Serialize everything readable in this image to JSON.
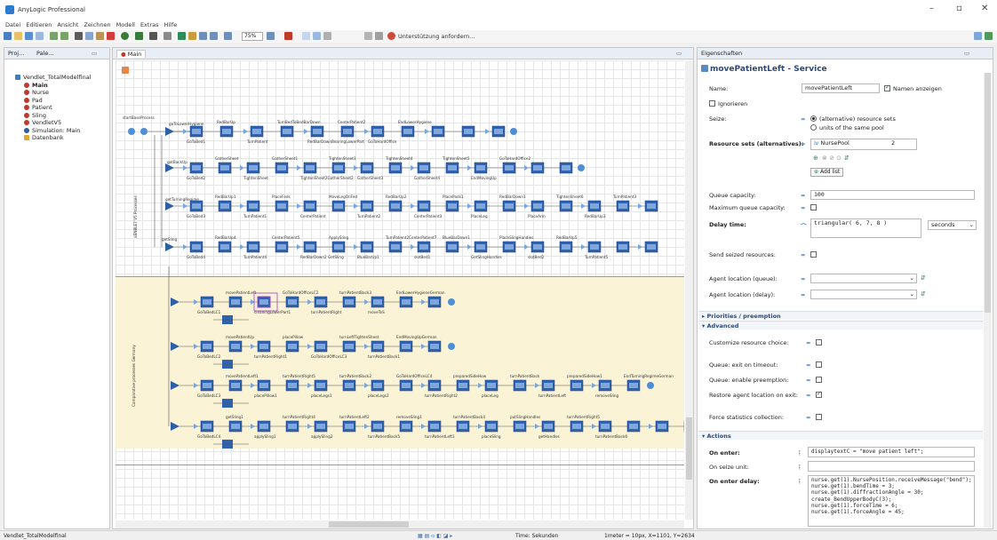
{
  "window": {
    "title": "AnyLogic Professional"
  },
  "menu": [
    "Datei",
    "Editieren",
    "Ansicht",
    "Zeichnen",
    "Modell",
    "Extras",
    "Hilfe"
  ],
  "toolbar": {
    "zoom": "75%",
    "support_label": "Unterstützung anfordern..."
  },
  "left_panel": {
    "tabs": [
      "Proj...",
      "Pale..."
    ],
    "tree": [
      "Vendlet_TotalModelfinal",
      "Main",
      "Nurse",
      "Pad",
      "Patient",
      "Sling",
      "VendletV5",
      "Simulation: Main",
      "Datenbank"
    ]
  },
  "editor": {
    "tab": "Main",
    "row_labels": [
      "startBaseProcess",
      "goToLowerHygiene",
      "gotBackUp",
      "getTurningRegime",
      "getSling"
    ],
    "row_node_labels": [
      [
        "GoToBed1",
        "RedBarUp",
        "TurnPatient",
        "TurnBedToBedBarDown",
        "RedBarDownBearingLowerPart",
        "CenterPatient2",
        "GoToHardOffice",
        "EndLowerHygiene"
      ],
      [
        "GoToBed2",
        "GatherSheet",
        "TightenSheet",
        "GatherSheet1",
        "TightenSheet2GatherSheet2",
        "TightenSheet3",
        "GatherSheet3",
        "TightenSheet4",
        "GatherSheet4",
        "TightenSheet5",
        "EndMovingUp",
        "GoToHardOffice2"
      ],
      [
        "GoToBed3",
        "RedBarUp1",
        "TurnPatient1",
        "PlaceFeds",
        "CenterPatient",
        "MoveLegOnFed",
        "TurnPatient2",
        "RedBarUp2",
        "CenterPatient3",
        "PlacePads1",
        "PlaceLeg",
        "RedBarDown1",
        "PlaceArm",
        "TightenSheet6",
        "RedBarUp3",
        "TurnPatient3"
      ],
      [
        "GoToBed4",
        "RedBarUp4",
        "TurnPatient4",
        "CenterPatient5",
        "RedBarDown2 GetSling",
        "ApplySling",
        "BlueBarUp1",
        "TurnPatient2CenterPatient7",
        "slotBed1",
        "BlueBarDown1",
        "GetSlingHandles",
        "PlaceSlingHandles",
        "slotBed2",
        "RedBarUp5",
        "TurnPatient5"
      ]
    ],
    "yellow_row_labels": [
      [
        "GoToBedLC1",
        "movePatientLeft",
        "cleaningLowerPart1",
        "GoToHardOfficeLC2",
        "turnPatientRight",
        "turnPatientBack3",
        "moveToS",
        "EndLowerHygieneGerman"
      ],
      [
        "GoToBedLC2",
        "movePatientUp",
        "turnPatientRight1",
        "placePillow",
        "GoToHardOfficeLC3",
        "turnLeftTightenSheet",
        "turnPatientBack1",
        "EndMovingUpGerman"
      ],
      [
        "GoToBedLC3",
        "movePatientLeft1",
        "placePillow1",
        "turnPatientRight5",
        "placeLegs1",
        "turnPatientBack2",
        "placeLegs2",
        "GoToHardOfficeLC4",
        "turnPatientRight2",
        "preparedSideHow",
        "placeLeg",
        "turnPatientBack",
        "turnPatientLeft",
        "preparedSideHow1",
        "removeSling",
        "EndTurningRegimeGerman"
      ],
      [
        "GoToBedLC4",
        "getSling1",
        "applySling1",
        "turnPatientRight4",
        "applySling2",
        "turnPatientLeft2",
        "turnPatientBack5",
        "removeSling1",
        "turnPatientLeft1",
        "turnPatientBack4",
        "placeSling",
        "putSlingHandles",
        "getHandles",
        "turnPatientRight5",
        "turnPatientBack6"
      ]
    ],
    "vertical_labels": [
      "aENBLE7 V5 Processes",
      "Comparative processes Germany"
    ]
  },
  "properties": {
    "tab": "Eigenschaften",
    "title": "movePatientLeft - Service",
    "name_label": "Name:",
    "name_value": "movePatientLeft",
    "show_name_label": "Namen anzeigen",
    "ignore_label": "Ignorieren",
    "seize_label": "Seize:",
    "seize_opt1": "(alternative) resource sets",
    "seize_opt2": "units of the same pool",
    "resource_sets_label": "Resource sets (alternatives):",
    "resource_pool": "NursePool",
    "resource_count": "2",
    "add_list": "Add list",
    "queue_capacity_label": "Queue capacity:",
    "queue_capacity_value": "100",
    "max_queue_label": "Maximum queue capacity:",
    "delay_time_label": "Delay time:",
    "delay_time_value": "triangular( 6, 7, 8 )",
    "delay_unit": "seconds",
    "send_seized_label": "Send seized resources:",
    "agent_loc_queue_label": "Agent location (queue):",
    "agent_loc_delay_label": "Agent location (delay):",
    "sec_priorities": "Priorities / preemption",
    "sec_advanced": "Advanced",
    "customize_label": "Customize resource choice:",
    "queue_exit_label": "Queue: exit on timeout:",
    "queue_preempt_label": "Queue: enable preemption:",
    "restore_label": "Restore agent location on exit:",
    "force_stats_label": "Force statistics collection:",
    "sec_actions": "Actions",
    "on_enter_label": "On enter:",
    "on_enter_code": "displaytextC = \"move patient left\";",
    "on_seize_label": "On seize unit:",
    "on_enter_delay_label": "On enter delay:",
    "on_enter_delay_code": [
      "nurse.get(1).NursePosition.receiveMessage(\"bend\");",
      "nurse.get(1).bendTime = 3;",
      "nurse.get(1).diffractionAngle = 30;",
      "create_BendUpperBodyC(3);",
      "nurse.get(1).forceTime = 6;",
      "nurse.get(1).forceAngle = 45;"
    ]
  },
  "status": {
    "model": "Vendlet_TotalModelfinal",
    "time": "Time: Sekunden",
    "coords": "1meter = 10px, X=1101, Y=2634"
  }
}
